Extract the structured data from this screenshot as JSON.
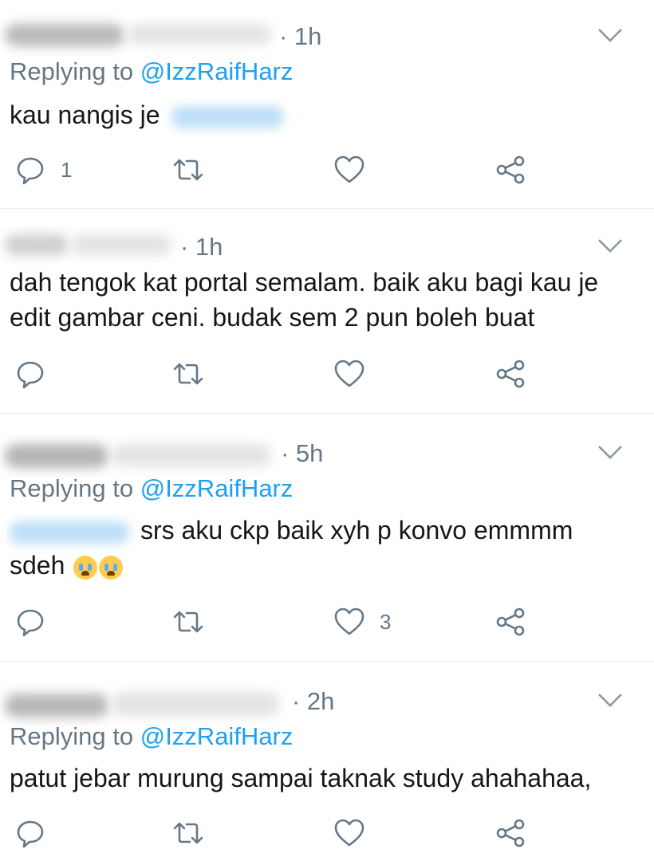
{
  "tweets": [
    {
      "time": "· 1h",
      "replying_prefix": "Replying to ",
      "replying_handle": "@IzzRaifHarz",
      "text_before": "kau nangis je",
      "text_lines": [],
      "reply_count": "1",
      "like_count": ""
    },
    {
      "time": "· 1h",
      "text_lines": [
        "dah tengok kat portal semalam. baik aku bagi kau je",
        "edit gambar ceni. budak sem 2 pun boleh buat"
      ],
      "reply_count": "",
      "like_count": ""
    },
    {
      "time": "· 5h",
      "replying_prefix": "Replying to ",
      "replying_handle": "@IzzRaifHarz",
      "text_after_mention": "srs aku ckp baik xyh p konvo emmmm",
      "text_line2": "sdeh",
      "reply_count": "",
      "like_count": "3"
    },
    {
      "time": "· 2h",
      "replying_prefix": "Replying to ",
      "replying_handle": "@IzzRaifHarz",
      "text_lines": [
        "patut jebar murung sampai taknak study ahahahaa,"
      ],
      "reply_count": "",
      "like_count": ""
    }
  ],
  "icons": {
    "reply": "reply-bubble-icon",
    "retweet": "retweet-icon",
    "like": "heart-icon",
    "share": "share-icon",
    "menu": "chevron-down-icon",
    "emoji": "crying-face-emoji"
  },
  "colors": {
    "link": "#1da1f2",
    "secondary_text": "#657786",
    "divider": "#e6ecf0",
    "icon": "#657786"
  }
}
